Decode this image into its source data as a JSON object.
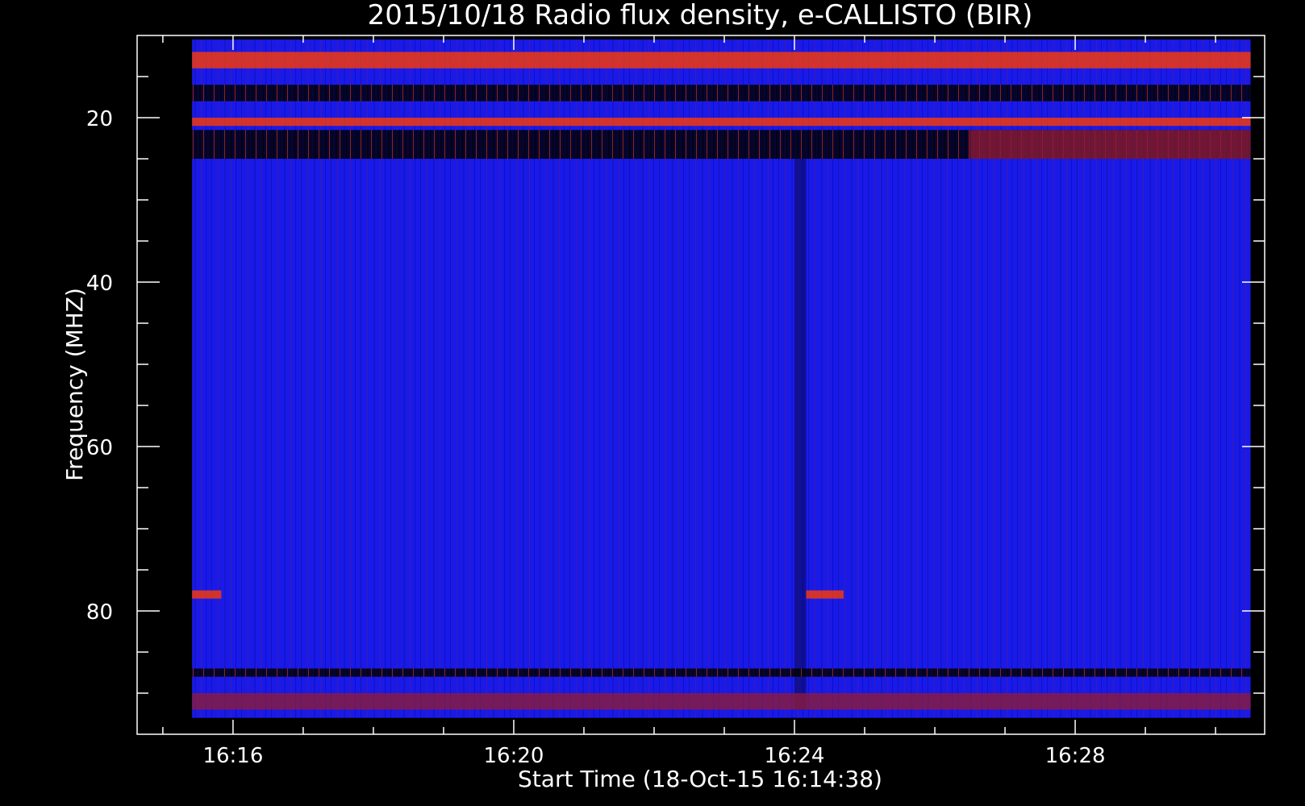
{
  "chart_data": {
    "type": "heatmap",
    "title": "2015/10/18  Radio flux density, e-CALLISTO (BIR)",
    "xlabel": "Start Time (18-Oct-15 16:14:38)",
    "ylabel": "Frequency (MHZ)",
    "x_unit": "minutes of day",
    "x_range": [
      "16:14:38",
      "16:30:42"
    ],
    "x_data_range": [
      "16:15:25",
      "16:30:30"
    ],
    "y_range": [
      95,
      10
    ],
    "y_data_range": [
      10.5,
      93
    ],
    "y_inverted": true,
    "x_ticks": [
      "16:16",
      "16:20",
      "16:24",
      "16:28"
    ],
    "y_ticks": [
      20,
      40,
      60,
      80
    ],
    "background_color": "#1a1ae8",
    "colors": {
      "low": "#000000",
      "mid": "#1a1ae8",
      "elevated": "#8b1a3a",
      "high": "#ff3a00",
      "peak": "#ffd000"
    },
    "features": [
      {
        "label": "rfi-band",
        "freq_range": [
          12,
          14
        ],
        "time_range": [
          "16:15:25",
          "16:30:30"
        ],
        "level": "high"
      },
      {
        "label": "rfi-band",
        "freq_range": [
          16,
          18
        ],
        "time_range": [
          "16:15:25",
          "16:30:30"
        ],
        "level": "low"
      },
      {
        "label": "rfi-band",
        "freq_range": [
          20,
          21
        ],
        "time_range": [
          "16:15:25",
          "16:30:30"
        ],
        "level": "high"
      },
      {
        "label": "rfi-band",
        "freq_range": [
          21.5,
          25
        ],
        "time_range": [
          "16:15:25",
          "16:30:30"
        ],
        "level": "low"
      },
      {
        "label": "rfi-band",
        "freq_range": [
          21.5,
          25
        ],
        "time_range": [
          "16:26:30",
          "16:30:30"
        ],
        "level": "elevated"
      },
      {
        "label": "dark-column",
        "freq_range": [
          25,
          92
        ],
        "time_range": [
          "16:24:00",
          "16:24:10"
        ],
        "level": "low"
      },
      {
        "label": "burst",
        "freq_range": [
          77.5,
          78.5
        ],
        "time_range": [
          "16:15:25",
          "16:15:50"
        ],
        "level": "high"
      },
      {
        "label": "burst",
        "freq_range": [
          77.5,
          78.5
        ],
        "time_range": [
          "16:24:10",
          "16:24:42"
        ],
        "level": "high"
      },
      {
        "label": "rfi-band",
        "freq_range": [
          87,
          88
        ],
        "time_range": [
          "16:15:25",
          "16:30:30"
        ],
        "level": "low"
      },
      {
        "label": "rfi-band",
        "freq_range": [
          90,
          92
        ],
        "time_range": [
          "16:15:25",
          "16:30:30"
        ],
        "level": "elevated"
      }
    ]
  }
}
